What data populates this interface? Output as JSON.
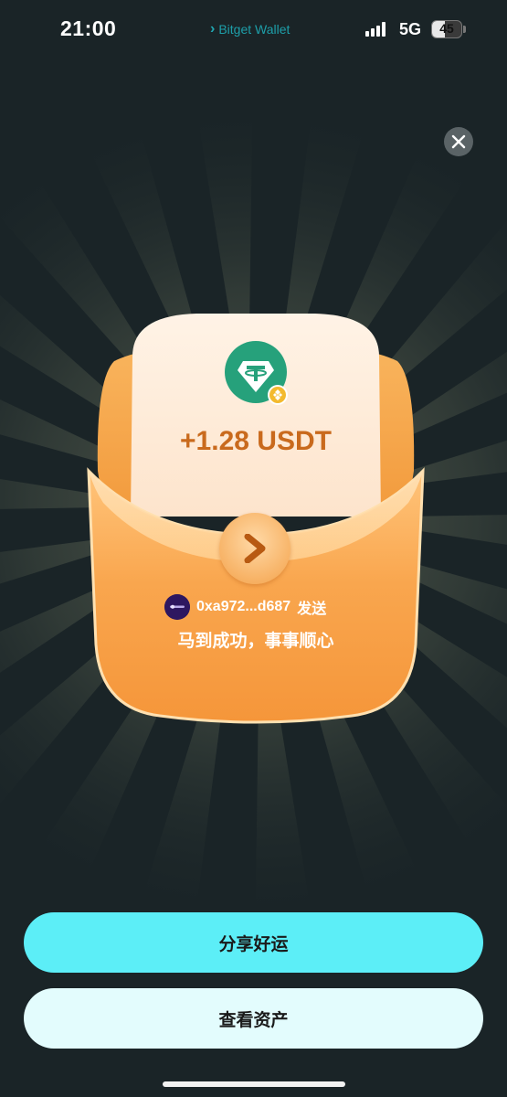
{
  "status_bar": {
    "time": "21:00",
    "app_name": "Bitget Wallet",
    "network": "5G",
    "battery": "45",
    "battery_level_percent": 45
  },
  "close": {
    "icon": "close-icon"
  },
  "reward": {
    "amount": "+1.28 USDT",
    "token_icon": "usdt-icon",
    "chain_badge_icon": "bnb-chain-icon",
    "sender_address": "0xa972...d687",
    "sender_suffix": "发送",
    "blessing": "马到成功，事事顺心",
    "open_icon": "chevron-right-icon"
  },
  "actions": {
    "share_label": "分享好运",
    "view_assets_label": "查看资产"
  },
  "colors": {
    "background": "#1a2427",
    "accent_cyan": "#5ceef7",
    "envelope_orange": "#f7a046",
    "amount_text": "#c96a1d",
    "usdt_teal": "#26a17b"
  }
}
